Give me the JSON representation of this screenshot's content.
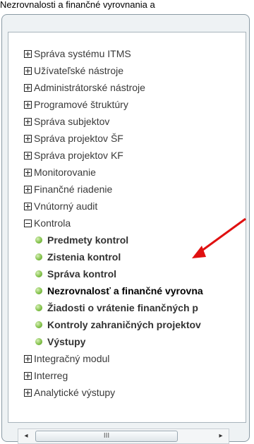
{
  "caption": "Nezrovnalosti a finančné vyrovnania a",
  "tree": {
    "items_top": [
      {
        "label": "Správa systému ITMS",
        "state": "collapsed"
      },
      {
        "label": "Užívateľské nástroje",
        "state": "collapsed"
      },
      {
        "label": "Administrátorské nástroje",
        "state": "collapsed"
      },
      {
        "label": "Programové štruktúry",
        "state": "collapsed"
      },
      {
        "label": "Správa subjektov",
        "state": "collapsed"
      },
      {
        "label": "Správa projektov ŠF",
        "state": "collapsed"
      },
      {
        "label": "Správa projektov KF",
        "state": "collapsed"
      },
      {
        "label": "Monitorovanie",
        "state": "collapsed"
      },
      {
        "label": "Finančné riadenie",
        "state": "collapsed"
      },
      {
        "label": "Vnútorný audit",
        "state": "collapsed"
      }
    ],
    "expanded": {
      "label": "Kontrola",
      "state": "expanded",
      "children": [
        {
          "label": "Predmety kontrol"
        },
        {
          "label": "Zistenia kontrol"
        },
        {
          "label": "Správa kontrol"
        },
        {
          "label": "Nezrovnalosť a finančné vyrovna",
          "selected": true
        },
        {
          "label": "Žiadosti o vrátenie finančných p"
        },
        {
          "label": "Kontroly zahraničných projektov"
        },
        {
          "label": "Výstupy"
        }
      ]
    },
    "items_bottom": [
      {
        "label": "Integračný modul",
        "state": "collapsed"
      },
      {
        "label": "Interreg",
        "state": "collapsed"
      },
      {
        "label": "Analytické výstupy",
        "state": "collapsed"
      }
    ]
  },
  "scrollbar": {
    "left_arrow": "◂",
    "right_arrow": "▸",
    "thumb_grip": "III"
  },
  "colors": {
    "annotation_arrow": "#e01010",
    "bullet": "#7fbf46"
  }
}
